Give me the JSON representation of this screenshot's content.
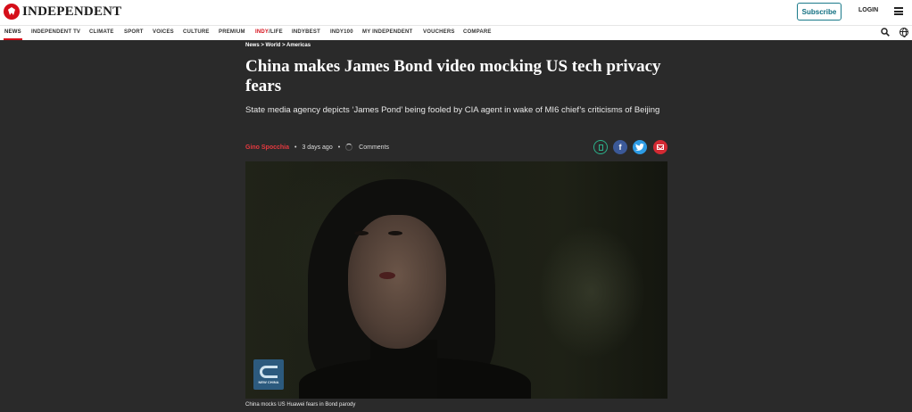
{
  "header": {
    "logo_text": "INDEPENDENT",
    "subscribe_label": "Subscribe",
    "login_label": "LOGIN"
  },
  "nav": {
    "items": [
      "NEWS",
      "INDEPENDENT TV",
      "CLIMATE",
      "SPORT",
      "VOICES",
      "CULTURE",
      "PREMIUM",
      "INDY/LIFE",
      "INDYBEST",
      "INDY100",
      "MY INDEPENDENT",
      "VOUCHERS",
      "COMPARE"
    ],
    "active": "NEWS",
    "indylife_prefix": "INDY",
    "indylife_suffix": "/LIFE"
  },
  "article": {
    "breadcrumb": "News > World > Americas",
    "headline": "China makes James Bond video mocking US tech privacy fears",
    "standfirst": "State media agency depicts ‘James Pond’ being fooled by CIA agent in wake of MI6 chief’s criticisms of Beijing",
    "author": "Gino Spocchia",
    "time": "3 days ago",
    "comments_label": "Comments",
    "video_logo_text": "NEW CHINA",
    "caption": "China mocks US Huawei fears in Bond parody"
  },
  "colors": {
    "brand_red": "#d50e19",
    "page_bg": "#2a2a2a",
    "subscribe_teal": "#0f6e80",
    "facebook": "#3b5998",
    "twitter": "#2d9be4",
    "email": "#d32a33"
  },
  "icons": [
    "eagle-logo-icon",
    "hamburger-menu-icon",
    "search-icon",
    "globe-icon",
    "bookmark-icon",
    "facebook-icon",
    "twitter-icon",
    "email-icon",
    "loading-spinner-icon"
  ]
}
